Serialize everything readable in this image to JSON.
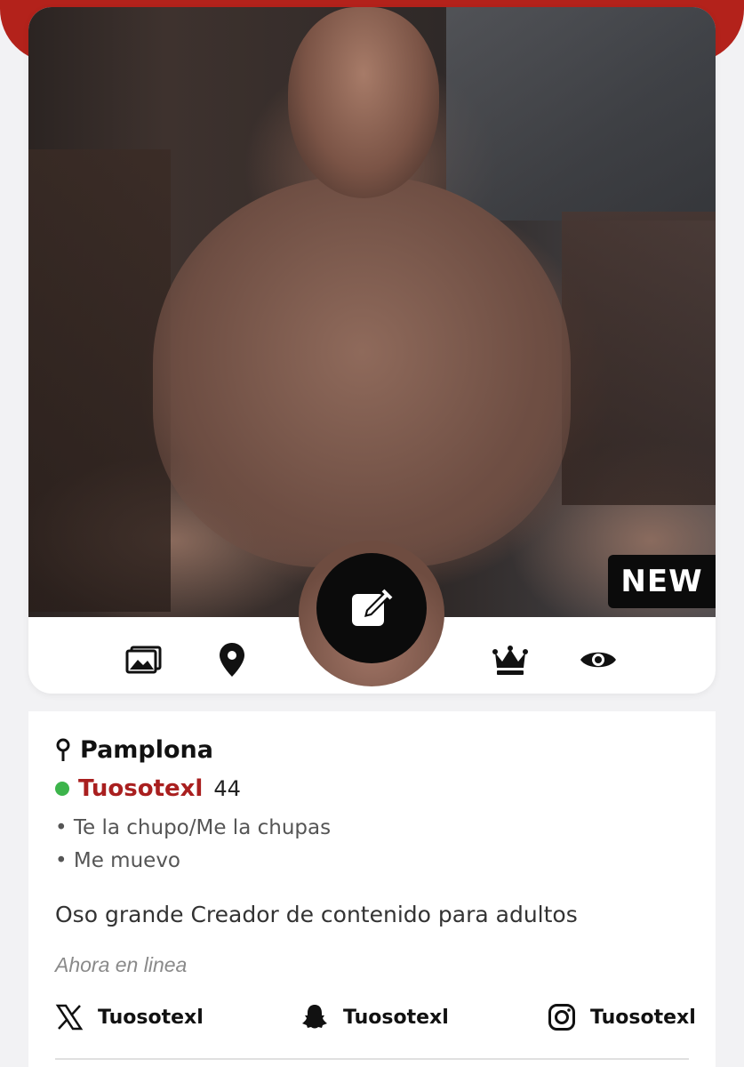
{
  "badge": {
    "new_label": "NEW"
  },
  "icons": {
    "photos": "photos-icon",
    "location": "location-pin-icon",
    "edit": "edit-icon",
    "premium": "crown-icon",
    "views": "eye-icon"
  },
  "profile": {
    "city": "Pamplona",
    "username": "Tuosotexl",
    "age": "44",
    "preferences": [
      "• Te la chupo/Me la chupas",
      "• Me muevo"
    ],
    "bio": "Oso grande Creador de contenido para adultos",
    "status": "Ahora en linea",
    "online_color": "#3cb44b",
    "username_color": "#a91f1f"
  },
  "socials": [
    {
      "network": "x-icon",
      "handle": "Tuosotexl"
    },
    {
      "network": "snapchat-icon",
      "handle": "Tuosotexl"
    },
    {
      "network": "instagram-icon",
      "handle": "Tuosotexl"
    }
  ],
  "theme": {
    "accent": "#b3221b"
  }
}
